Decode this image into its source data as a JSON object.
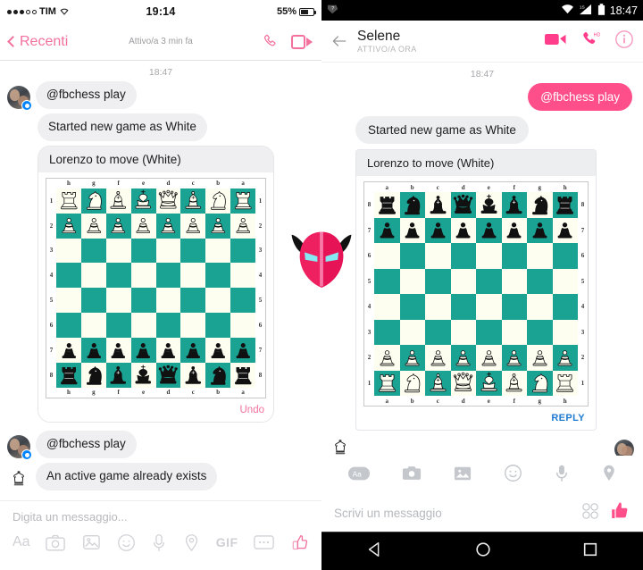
{
  "ios": {
    "status": {
      "carrier": "TIM",
      "time": "19:14",
      "battery": "55%"
    },
    "nav": {
      "back_label": "Recenti",
      "subtitle": "Attivo/a 3 min fa",
      "phone_icon": "phone-icon",
      "video_icon": "video-camera-icon"
    },
    "timestamp": "18:47",
    "messages": [
      {
        "id": "m1",
        "from": "user",
        "text": "@fbchess play"
      },
      {
        "id": "m2",
        "from": "bot",
        "text": "Started new game as White"
      }
    ],
    "card": {
      "caption": "Lorenzo to move (White)",
      "undo_label": "Undo"
    },
    "messages2": [
      {
        "id": "m3",
        "from": "user",
        "text": "@fbchess play"
      },
      {
        "id": "m4",
        "from": "bot",
        "text": "An active game already exists"
      }
    ],
    "composer": {
      "placeholder": "Digita un messaggio...",
      "tools": [
        {
          "name": "text-format-icon",
          "label": "Aa"
        },
        {
          "name": "camera-icon",
          "label": ""
        },
        {
          "name": "photo-gallery-icon",
          "label": ""
        },
        {
          "name": "sticker-smiley-icon",
          "label": ""
        },
        {
          "name": "microphone-icon",
          "label": ""
        },
        {
          "name": "location-pin-icon",
          "label": ""
        },
        {
          "name": "gif-icon",
          "label": "GIF"
        },
        {
          "name": "more-options-icon",
          "label": ""
        },
        {
          "name": "thumbs-up-icon",
          "label": ""
        }
      ]
    }
  },
  "android": {
    "status": {
      "time": "18:47",
      "signal": "signal-icon",
      "wifi": "wifi-icon",
      "battery": "battery-icon"
    },
    "nav": {
      "back_icon": "back-arrow-icon",
      "name": "Selene",
      "subtitle": "ATTIVO/A ORA",
      "video_icon": "video-camera-icon",
      "call_icon": "phone-hd-icon",
      "info_icon": "info-circle-icon"
    },
    "timestamp": "18:47",
    "messages": [
      {
        "id": "am1",
        "from": "me",
        "text": "@fbchess play"
      },
      {
        "id": "am2",
        "from": "bot",
        "text": "Started new game as White"
      }
    ],
    "card": {
      "caption": "Lorenzo to move (White)",
      "reply_label": "REPLY"
    },
    "composer": {
      "placeholder": "Scrivi un messaggio",
      "tools": [
        {
          "name": "text-format-icon",
          "label": "Aa"
        },
        {
          "name": "camera-icon",
          "label": ""
        },
        {
          "name": "photo-gallery-icon",
          "label": ""
        },
        {
          "name": "emoji-smiley-icon",
          "label": ""
        },
        {
          "name": "microphone-icon",
          "label": ""
        },
        {
          "name": "location-pin-icon",
          "label": ""
        }
      ],
      "sticker_icon": "sticker-icon",
      "like_icon": "thumbs-up-icon"
    },
    "navbar": [
      {
        "name": "nav-back-triangle-icon"
      },
      {
        "name": "nav-home-circle-icon"
      },
      {
        "name": "nav-recents-square-icon"
      }
    ]
  },
  "overlay": {
    "icon": "devil-mask-icon"
  },
  "colors": {
    "accent_pink": "#f2719e",
    "bubble_pink": "#ff4f8b",
    "board_dark": "#1aa293",
    "board_light": "#fdfdf0",
    "reply_blue": "#1f7bd1"
  },
  "chess": {
    "position_fen": "rnbqkbnr/pppppppp/8/8/8/8/PPPPPPPP/RNBQKBNR",
    "left_board": {
      "orientation": "black-bottom-flipped",
      "files": [
        "h",
        "g",
        "f",
        "e",
        "d",
        "c",
        "b",
        "a"
      ],
      "ranks": [
        "1",
        "2",
        "3",
        "4",
        "5",
        "6",
        "7",
        "8"
      ],
      "rows": [
        [
          "wR",
          "wN",
          "wB",
          "wK",
          "wQ",
          "wB",
          "wN",
          "wR"
        ],
        [
          "wP",
          "wP",
          "wP",
          "wP",
          "wP",
          "wP",
          "wP",
          "wP"
        ],
        [
          "",
          "",
          "",
          "",
          "",
          "",
          "",
          ""
        ],
        [
          "",
          "",
          "",
          "",
          "",
          "",
          "",
          ""
        ],
        [
          "",
          "",
          "",
          "",
          "",
          "",
          "",
          ""
        ],
        [
          "",
          "",
          "",
          "",
          "",
          "",
          "",
          ""
        ],
        [
          "bP",
          "bP",
          "bP",
          "bP",
          "bP",
          "bP",
          "bP",
          "bP"
        ],
        [
          "bR",
          "bN",
          "bB",
          "bK",
          "bQ",
          "bB",
          "bN",
          "bR"
        ]
      ],
      "top_left_square": "light"
    },
    "right_board": {
      "orientation": "white-bottom",
      "files": [
        "a",
        "b",
        "c",
        "d",
        "e",
        "f",
        "g",
        "h"
      ],
      "ranks": [
        "8",
        "7",
        "6",
        "5",
        "4",
        "3",
        "2",
        "1"
      ],
      "rows": [
        [
          "bR",
          "bN",
          "bB",
          "bQ",
          "bK",
          "bB",
          "bN",
          "bR"
        ],
        [
          "bP",
          "bP",
          "bP",
          "bP",
          "bP",
          "bP",
          "bP",
          "bP"
        ],
        [
          "",
          "",
          "",
          "",
          "",
          "",
          "",
          ""
        ],
        [
          "",
          "",
          "",
          "",
          "",
          "",
          "",
          ""
        ],
        [
          "",
          "",
          "",
          "",
          "",
          "",
          "",
          ""
        ],
        [
          "",
          "",
          "",
          "",
          "",
          "",
          "",
          ""
        ],
        [
          "wP",
          "wP",
          "wP",
          "wP",
          "wP",
          "wP",
          "wP",
          "wP"
        ],
        [
          "wR",
          "wN",
          "wB",
          "wQ",
          "wK",
          "wB",
          "wN",
          "wR"
        ]
      ],
      "top_left_square": "light"
    }
  }
}
